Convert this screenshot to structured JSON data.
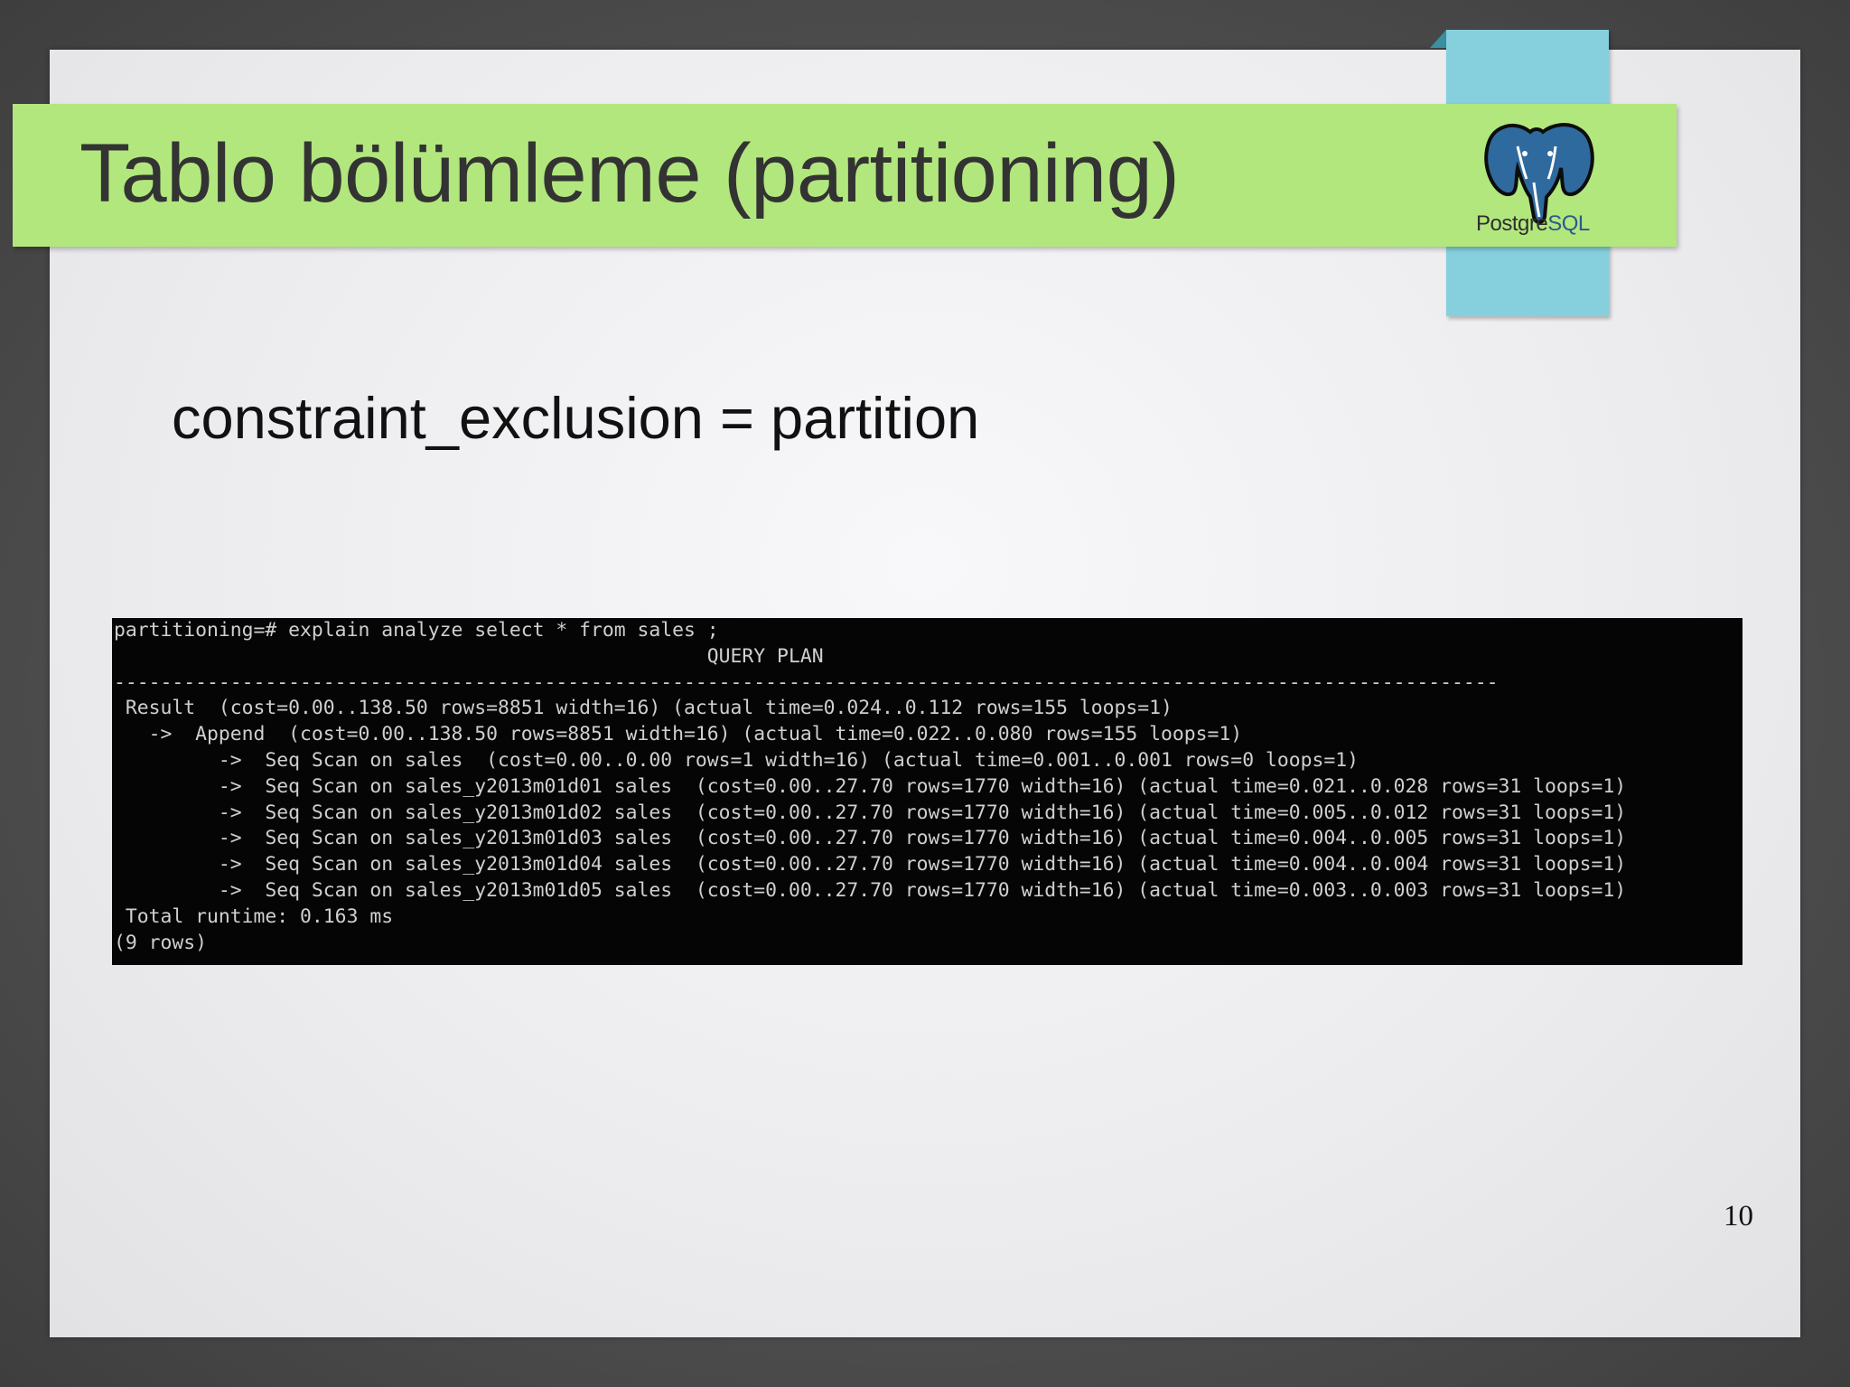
{
  "slide": {
    "title": "Tablo bölümleme (partitioning)",
    "subtitle": "constraint_exclusion = partition",
    "page_number": "10"
  },
  "logo": {
    "name": "postgresql-elephant-logo",
    "text_postgre": "Postgre",
    "text_sql": "SQL"
  },
  "terminal": {
    "lines": [
      "partitioning=# explain analyze select * from sales ;",
      "                                                   QUERY PLAN",
      "-----------------------------------------------------------------------------------------------------------------------",
      " Result  (cost=0.00..138.50 rows=8851 width=16) (actual time=0.024..0.112 rows=155 loops=1)",
      "   ->  Append  (cost=0.00..138.50 rows=8851 width=16) (actual time=0.022..0.080 rows=155 loops=1)",
      "         ->  Seq Scan on sales  (cost=0.00..0.00 rows=1 width=16) (actual time=0.001..0.001 rows=0 loops=1)",
      "         ->  Seq Scan on sales_y2013m01d01 sales  (cost=0.00..27.70 rows=1770 width=16) (actual time=0.021..0.028 rows=31 loops=1)",
      "         ->  Seq Scan on sales_y2013m01d02 sales  (cost=0.00..27.70 rows=1770 width=16) (actual time=0.005..0.012 rows=31 loops=1)",
      "         ->  Seq Scan on sales_y2013m01d03 sales  (cost=0.00..27.70 rows=1770 width=16) (actual time=0.004..0.005 rows=31 loops=1)",
      "         ->  Seq Scan on sales_y2013m01d04 sales  (cost=0.00..27.70 rows=1770 width=16) (actual time=0.004..0.004 rows=31 loops=1)",
      "         ->  Seq Scan on sales_y2013m01d05 sales  (cost=0.00..27.70 rows=1770 width=16) (actual time=0.003..0.003 rows=31 loops=1)",
      " Total runtime: 0.163 ms",
      "(9 rows)"
    ]
  },
  "colors": {
    "title_bar": "#b2e77d",
    "logo_tab": "#86d0de",
    "terminal_bg": "#050505",
    "terminal_text": "#cfcfcf"
  }
}
